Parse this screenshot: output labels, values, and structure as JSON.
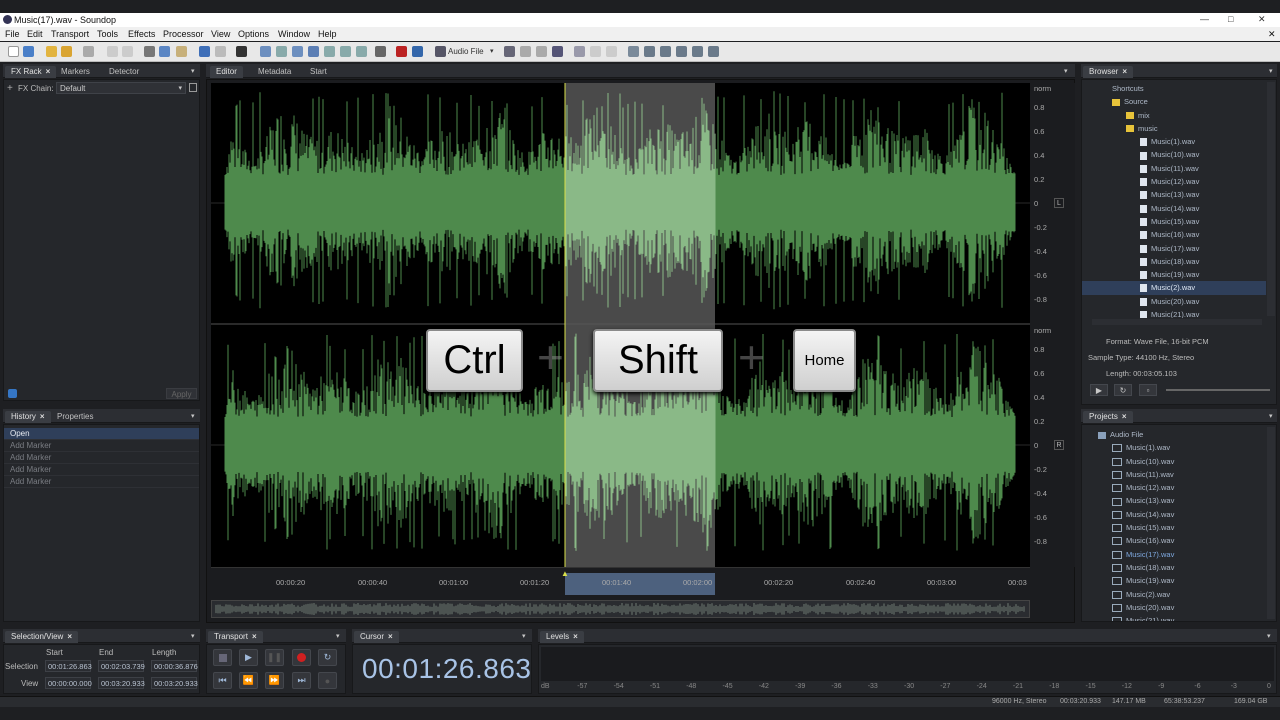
{
  "window": {
    "title": "Music(17).wav - Soundop"
  },
  "menu": [
    "File",
    "Edit",
    "Transport",
    "Tools",
    "Effects",
    "Processor",
    "View",
    "Options",
    "Window",
    "Help"
  ],
  "toolbar": {
    "audio_file_label": "Audio File"
  },
  "left_top": {
    "tabs": [
      "FX Rack",
      "Markers",
      "Detector"
    ],
    "fx_chain_label": "FX Chain:",
    "fx_chain_value": "Default",
    "apply_label": "Apply"
  },
  "history": {
    "tabs": [
      "History",
      "Properties"
    ],
    "items": [
      "Open",
      "Add Marker",
      "Add Marker",
      "Add Marker",
      "Add Marker"
    ]
  },
  "editor": {
    "tabs": [
      "Editor",
      "Metadata",
      "Start"
    ],
    "scale_top": [
      "norm",
      "0.8",
      "0.6",
      "0.4",
      "0.2",
      "0",
      "-0.2",
      "-0.4",
      "-0.6",
      "-0.8"
    ],
    "scale_bottom": [
      "norm",
      "0.8",
      "0.6",
      "0.4",
      "0.2",
      "0",
      "-0.2",
      "-0.4",
      "-0.6",
      "-0.8"
    ],
    "channel_left": "L",
    "channel_right": "R",
    "time_ticks": [
      "00:00:20",
      "00:00:40",
      "00:01:00",
      "00:01:20",
      "00:01:40",
      "00:02:00",
      "00:02:20",
      "00:02:40",
      "00:03:00",
      "00:03"
    ],
    "keys": {
      "k1": "Ctrl",
      "plus1": "+",
      "k2": "Shift",
      "plus2": "+",
      "k3": "Home"
    },
    "colors": {
      "wave": "#4e8a4c",
      "wave_selected": "#8ab987",
      "selection_bg": "#4a4a4a",
      "cursor": "#d9e04a"
    }
  },
  "browser": {
    "tab": "Browser",
    "shortcuts": "Shortcuts",
    "source": "Source",
    "folders": [
      "mix",
      "music"
    ],
    "files": [
      "Music(1).wav",
      "Music(10).wav",
      "Music(11).wav",
      "Music(12).wav",
      "Music(13).wav",
      "Music(14).wav",
      "Music(15).wav",
      "Music(16).wav",
      "Music(17).wav",
      "Music(18).wav",
      "Music(19).wav",
      "Music(2).wav",
      "Music(20).wav",
      "Music(21).wav"
    ],
    "selected": "Music(2).wav",
    "format": "Format: Wave File, 16-bit PCM",
    "sample_type": "Sample Type: 44100 Hz, Stereo",
    "length": "Length: 00:03:05.103"
  },
  "projects": {
    "tab": "Projects",
    "root": "Audio File",
    "files": [
      "Music(1).wav",
      "Music(10).wav",
      "Music(11).wav",
      "Music(12).wav",
      "Music(13).wav",
      "Music(14).wav",
      "Music(15).wav",
      "Music(16).wav",
      "Music(17).wav",
      "Music(18).wav",
      "Music(19).wav",
      "Music(2).wav",
      "Music(20).wav",
      "Music(21).wav"
    ],
    "active": "Music(17).wav"
  },
  "selection_view": {
    "tab": "Selection/View",
    "col_start": "Start",
    "col_end": "End",
    "col_length": "Length",
    "row_selection": "Selection",
    "row_view": "View",
    "sel_start": "00:01:26.863",
    "sel_end": "00:02:03.739",
    "sel_length": "00:00:36.876",
    "view_start": "00:00:00.000",
    "view_end": "00:03:20.933",
    "view_length": "00:03:20.933"
  },
  "transport": {
    "tab": "Transport"
  },
  "cursor": {
    "tab": "Cursor",
    "time": "00:01:26.863"
  },
  "levels": {
    "tab": "Levels",
    "ticks": [
      "dB",
      "-57",
      "-54",
      "-51",
      "-48",
      "-45",
      "-42",
      "-39",
      "-36",
      "-33",
      "-30",
      "-27",
      "-24",
      "-21",
      "-18",
      "-15",
      "-12",
      "-9",
      "-6",
      "-3",
      "0"
    ]
  },
  "status": {
    "format": "96000 Hz, Stereo",
    "duration": "00:03:20.933",
    "size": "147.17 MB",
    "free_time": "65:38:53.237",
    "free_space": "169.04 GB"
  }
}
